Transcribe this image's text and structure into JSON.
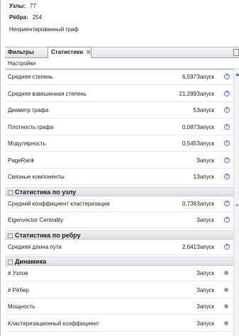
{
  "graph_info": {
    "nodes_label": "Узлы:",
    "nodes_value": "77",
    "edges_label": "Рёбра:",
    "edges_value": "254",
    "graph_type": "Неориентированный граф"
  },
  "tabs": [
    {
      "label": "Фильтры"
    },
    {
      "label": "Статистики",
      "close": "⌘"
    }
  ],
  "settings_label": "Настройки",
  "run_label": "Запуск",
  "rows_network": [
    {
      "label": "Средняя степень",
      "value": "6,597"
    },
    {
      "label": "Средняя взвешенная степень",
      "value": "21,299"
    },
    {
      "label": "Диаметр графа",
      "value": "5"
    },
    {
      "label": "Плотность графа",
      "value": "0,087"
    },
    {
      "label": "Модулярность",
      "value": "0,545"
    },
    {
      "label": "PageRank",
      "value": ""
    },
    {
      "label": "Связные компоненты",
      "value": "1"
    }
  ],
  "section_node": {
    "title": "Статистика по узлу",
    "toggle": "−"
  },
  "rows_node": [
    {
      "label": "Средний коэффициент кластеризации",
      "value": "0,736"
    },
    {
      "label": "Eigenvector Centrality",
      "value": ""
    }
  ],
  "section_edge": {
    "title": "Статистика по ребру",
    "toggle": "−"
  },
  "rows_edge": [
    {
      "label": "Средняя длина пути",
      "value": "2,641"
    }
  ],
  "section_dynamic": {
    "title": "Динамика",
    "toggle": "−"
  },
  "rows_dynamic": [
    {
      "label": "# Узлов",
      "value": ""
    },
    {
      "label": "# Рёбер",
      "value": ""
    },
    {
      "label": "Мощность",
      "value": ""
    },
    {
      "label": "Кластеризационный коэффициент",
      "value": ""
    }
  ],
  "colors": {
    "help_icon": "#3a4fc9",
    "disabled_dot": "#9a9a9a"
  },
  "icons": {
    "help": "help-icon",
    "status": "status-dot-icon"
  }
}
